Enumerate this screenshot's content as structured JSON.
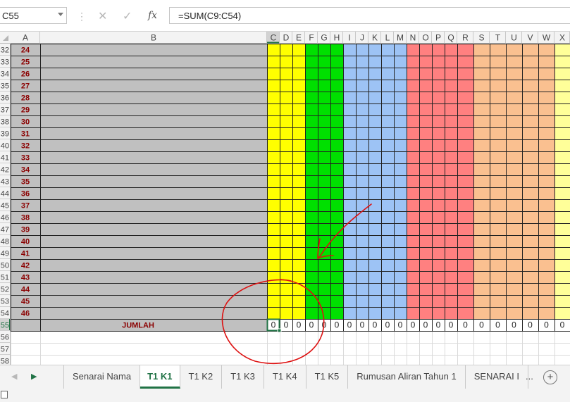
{
  "formula_bar": {
    "name_box": "C55",
    "cancel_icon": "✕",
    "enter_icon": "✓",
    "fx_label": "fx",
    "formula": "=SUM(C9:C54)"
  },
  "columns": [
    "A",
    "B",
    "C",
    "D",
    "E",
    "F",
    "G",
    "H",
    "I",
    "J",
    "K",
    "L",
    "M",
    "N",
    "O",
    "P",
    "Q",
    "R",
    "S",
    "T",
    "U",
    "V",
    "W",
    "X"
  ],
  "row_headers": [
    "32",
    "33",
    "34",
    "35",
    "36",
    "37",
    "38",
    "39",
    "40",
    "41",
    "42",
    "43",
    "44",
    "45",
    "46",
    "47",
    "48",
    "49",
    "50",
    "51",
    "52",
    "53",
    "54",
    "55",
    "56",
    "57",
    "58"
  ],
  "student_numbers": [
    "24",
    "25",
    "26",
    "27",
    "28",
    "29",
    "30",
    "31",
    "32",
    "33",
    "34",
    "35",
    "36",
    "37",
    "38",
    "39",
    "40",
    "41",
    "42",
    "43",
    "44",
    "45",
    "46"
  ],
  "total_row": {
    "label": "JUMLAH",
    "values": [
      "0",
      "0",
      "0",
      "0",
      "0",
      "0",
      "0",
      "0",
      "0",
      "0",
      "0",
      "0",
      "0",
      "0",
      "0",
      "0",
      "0",
      "0",
      "0",
      "0",
      "0",
      "0"
    ]
  },
  "colors": {
    "gray_fill": "#c0c0c0",
    "yellow": "#ffff00",
    "green": "#00e000",
    "blue": "#9dc3f5",
    "red": "#ff8080",
    "orange": "#fac090",
    "light_yellow": "#ffff99",
    "number_text": "#8b0000",
    "accent": "#217346",
    "annotation": "#dd1111"
  },
  "sheet_tabs": {
    "tabs": [
      "Senarai Nama",
      "T1 K1",
      "T1 K2",
      "T1 K3",
      "T1 K4",
      "T1 K5",
      "Rumusan Aliran Tahun 1",
      "SENARAI I"
    ],
    "active_index": 1,
    "more_label": "...",
    "add_label": "+",
    "prev_icon": "◀",
    "next_icon": "▶"
  }
}
